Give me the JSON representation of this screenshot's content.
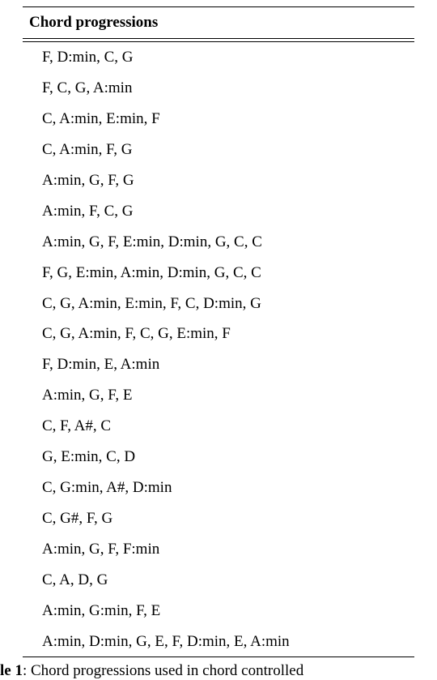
{
  "table": {
    "header": "Chord progressions",
    "rows": [
      "F, D:min, C, G",
      "F, C, G, A:min",
      "C, A:min, E:min, F",
      "C, A:min, F, G",
      "A:min, G, F, G",
      "A:min, F, C, G",
      "A:min, G, F, E:min, D:min, G, C, C",
      "F, G, E:min, A:min, D:min, G, C, C",
      "C, G, A:min, E:min, F, C, D:min, G",
      "C, G, A:min, F, C, G, E:min, F",
      "F, D:min, E, A:min",
      "A:min, G, F, E",
      "C, F, A#, C",
      "G, E:min, C, D",
      "C, G:min, A#, D:min",
      "C, G#, F, G",
      "A:min, G, F, F:min",
      "C, A, D, G",
      "A:min, G:min, F, E",
      "A:min, D:min, G, E, F, D:min, E, A:min"
    ]
  },
  "caption": {
    "label": "le 1",
    "text": ": Chord progressions used in chord controlled"
  }
}
